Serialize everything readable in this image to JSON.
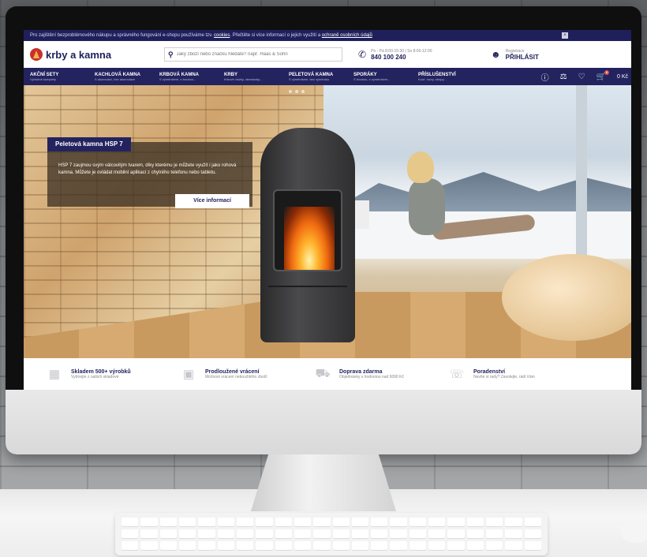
{
  "cookie_bar": {
    "text": "Pro zajištění bezproblémového nákupu a správného fungování e-shopu používáme tzv.",
    "link_cookies": "cookies",
    "text2": ". Přečtěte si více informací o jejich využití a",
    "link_privacy": "ochraně osobních údajů",
    "close_symbol": "×"
  },
  "header": {
    "logo_text": "krby a kamna",
    "search_placeholder": "Jaký zboží nebo značku hledáte? např. Haas & Sohn",
    "phone_small": "Po - Pá 8:00-15:30 | So 8:00-12:00",
    "phone_number": "840 100 240",
    "login_small": "Registrace",
    "login_label": "PŘIHLÁSIT"
  },
  "nav": {
    "items": [
      {
        "title": "AKČNÍ SETY",
        "sub": "Výhodné komplety"
      },
      {
        "title": "KACHLOVÁ KAMNA",
        "sub": "S akumulací, bez akumulace"
      },
      {
        "title": "KRBOVÁ KAMNA",
        "sub": "S výměníkem, s troubou..."
      },
      {
        "title": "KRBY",
        "sub": "Krbové vložky, obestavby..."
      },
      {
        "title": "PELETOVÁ KAMNA",
        "sub": "S výměníkem, bez výměníku"
      },
      {
        "title": "SPORÁKY",
        "sub": "S troubou, s výměníkem..."
      },
      {
        "title": "PŘÍSLUŠENSTVÍ",
        "sub": "Kouř. roury, stropy..."
      }
    ],
    "price": "0 Kč",
    "cart_badge": "0"
  },
  "hero": {
    "title": "Peletová kamna HSP 7",
    "text": "HSP 7 zaujmou svým válcovitým tvarem, díky kterému je můžete využít i jako rohová kamna. Můžete je ovládat mobilní aplikací z chytrého telefonu nebo tabletu.",
    "button": "Více informací"
  },
  "features": [
    {
      "title": "Skladem 500+ výrobků",
      "sub": "Vybírejte z našich skladové",
      "icon": "warehouse-icon"
    },
    {
      "title": "Prodloužené vrácení",
      "sub": "Možnost vrácení neboužitého zboží",
      "icon": "box-return-icon"
    },
    {
      "title": "Doprava zdarma",
      "sub": "Objednávky s hodnotou nad 9090 Kč",
      "icon": "truck-icon"
    },
    {
      "title": "Poradenství",
      "sub": "Nevíte si rady? Zavolejte, rádi Vám",
      "icon": "headset-icon"
    }
  ],
  "colors": {
    "brand": "#23235f",
    "accent": "#c9302c"
  }
}
